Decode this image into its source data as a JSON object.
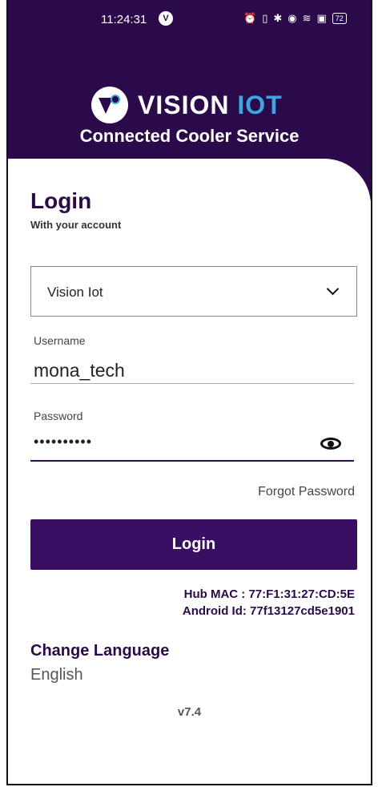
{
  "status_bar": {
    "time": "11:24:31",
    "battery": "72"
  },
  "brand": {
    "logo_part1": "VISION",
    "logo_part2": "IOT",
    "subtitle": "Connected Cooler Service"
  },
  "login": {
    "title": "Login",
    "subtitle": "With your account",
    "selected_account": "Vision Iot",
    "username_label": "Username",
    "username_value": "mona_tech",
    "password_label": "Password",
    "password_value": "••••••••••",
    "forgot_password": "Forgot Password",
    "login_button": "Login"
  },
  "device": {
    "hub_mac": "Hub MAC : 77:F1:31:27:CD:5E",
    "android_id": "Android Id: 77f13127cd5e1901"
  },
  "language": {
    "title": "Change Language",
    "value": "English"
  },
  "version": "v7.4",
  "colors": {
    "primary": "#2a0a4a",
    "button": "#3a0f63",
    "accent": "#3aa8e0"
  },
  "icons": [
    "alarm-icon",
    "vibrate-icon",
    "bluetooth-icon",
    "location-icon",
    "wifi-icon",
    "nfc-icon",
    "battery-icon",
    "chevron-down-icon",
    "eye-icon"
  ]
}
